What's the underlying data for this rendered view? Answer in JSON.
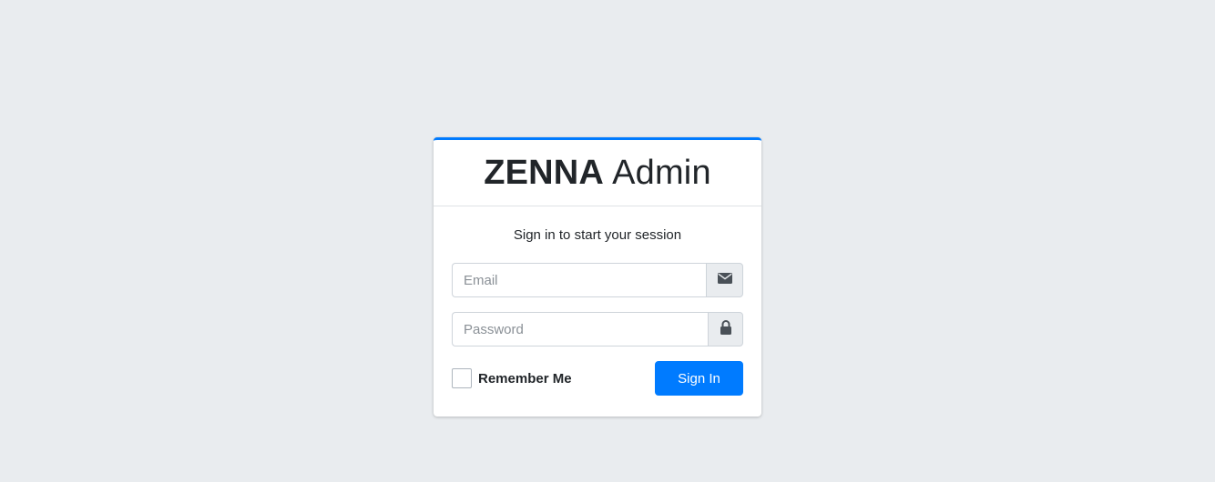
{
  "login_box": {
    "brand_bold": "ZENNA",
    "brand_light": "Admin",
    "message": "Sign in to start your session",
    "email": {
      "placeholder": "Email",
      "value": "",
      "icon": "envelope-icon"
    },
    "password": {
      "placeholder": "Password",
      "value": "",
      "icon": "lock-icon"
    },
    "remember_label": "Remember Me",
    "remember_checked": false,
    "signin_label": "Sign In"
  },
  "colors": {
    "background": "#e9ecef",
    "accent": "#007bff",
    "card": "#ffffff",
    "addon": "#e9ecef"
  }
}
